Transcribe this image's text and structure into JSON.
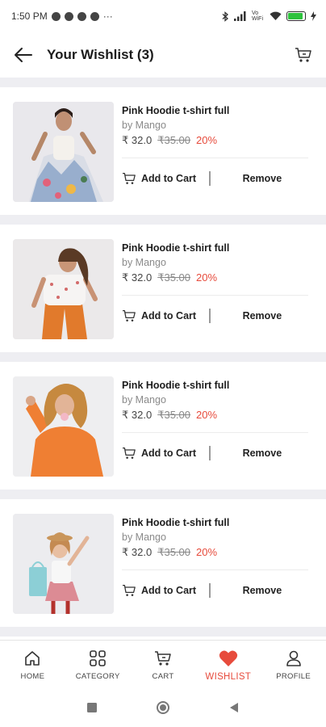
{
  "status_bar": {
    "time": "1:50 PM",
    "dots": "···",
    "network": "Vo WiFi",
    "battery_level": 0.9,
    "battery_color": "#2ec23d"
  },
  "header": {
    "title": "Your Wishlist (3)",
    "back_icon": "arrow-left-icon",
    "cart_icon": "cart-icon"
  },
  "colors": {
    "accent": "#e74b3c",
    "separator": "#eeeef2"
  },
  "items": [
    {
      "name": "Pink Hoodie t-shirt full",
      "brand": "by Mango",
      "price": "₹ 32.0",
      "mrp": "₹35.00",
      "discount": "20%",
      "add_label": "Add to Cart",
      "remove_label": "Remove",
      "image": "woman-floral-skirt"
    },
    {
      "name": "Pink Hoodie t-shirt full",
      "brand": "by Mango",
      "price": "₹ 32.0",
      "mrp": "₹35.00",
      "discount": "20%",
      "add_label": "Add to Cart",
      "remove_label": "Remove",
      "image": "woman-orange-pants"
    },
    {
      "name": "Pink Hoodie t-shirt full",
      "brand": "by Mango",
      "price": "₹ 32.0",
      "mrp": "₹35.00",
      "discount": "20%",
      "add_label": "Add to Cart",
      "remove_label": "Remove",
      "image": "woman-orange-sweater"
    },
    {
      "name": "Pink Hoodie t-shirt full",
      "brand": "by Mango",
      "price": "₹ 32.0",
      "mrp": "₹35.00",
      "discount": "20%",
      "add_label": "Add to Cart",
      "remove_label": "Remove",
      "image": "girl-shopping-bags"
    }
  ],
  "bottom_nav": [
    {
      "label": "HOME",
      "icon": "home-icon",
      "active": false
    },
    {
      "label": "CATEGORY",
      "icon": "grid-icon",
      "active": false
    },
    {
      "label": "CART",
      "icon": "cart-icon",
      "active": false
    },
    {
      "label": "WISHLIST",
      "icon": "heart-icon",
      "active": true
    },
    {
      "label": "PROFILE",
      "icon": "user-icon",
      "active": false
    }
  ],
  "system_nav": [
    "square-icon",
    "circle-icon",
    "triangle-back-icon"
  ]
}
